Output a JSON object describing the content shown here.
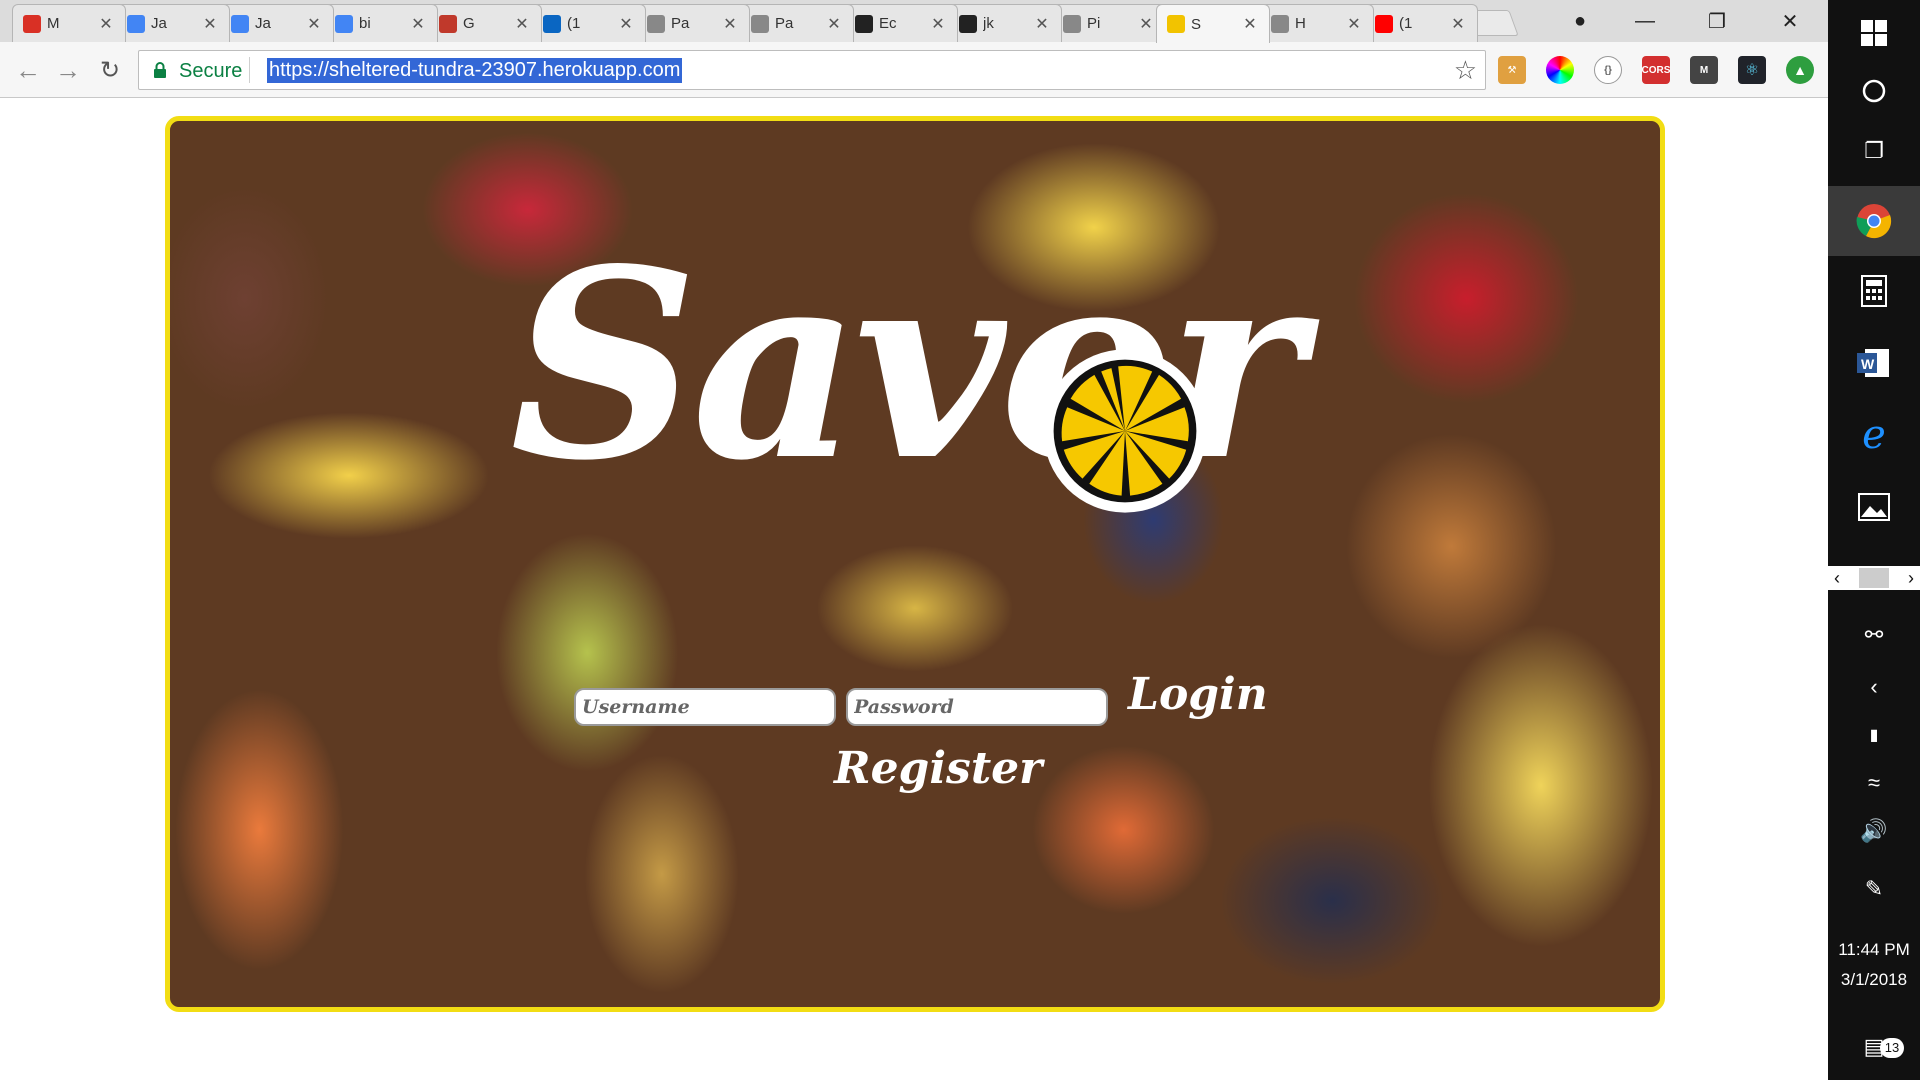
{
  "browser": {
    "tabs": [
      {
        "title": "M",
        "favicon": "gmail-icon",
        "color": "#d93025"
      },
      {
        "title": "Ja",
        "favicon": "docs-icon",
        "color": "#4285f4"
      },
      {
        "title": "Ja",
        "favicon": "docs-icon",
        "color": "#4285f4"
      },
      {
        "title": "bi",
        "favicon": "google-icon",
        "color": "#4285f4"
      },
      {
        "title": "G",
        "favicon": "clapperboard-icon",
        "color": "#c0392b"
      },
      {
        "title": "(1",
        "favicon": "linkedin-icon",
        "color": "#0a66c2"
      },
      {
        "title": "Pa",
        "favicon": "page-icon",
        "color": "#888888"
      },
      {
        "title": "Pa",
        "favicon": "page-icon",
        "color": "#888888"
      },
      {
        "title": "Ec",
        "favicon": "github-icon",
        "color": "#222222"
      },
      {
        "title": "jk",
        "favicon": "github-icon",
        "color": "#222222"
      },
      {
        "title": "Pi",
        "favicon": "page-icon",
        "color": "#888888"
      },
      {
        "title": "S",
        "favicon": "lemon-icon",
        "color": "#f2c300"
      },
      {
        "title": "H",
        "favicon": "page-icon",
        "color": "#888888"
      },
      {
        "title": "(1",
        "favicon": "youtube-icon",
        "color": "#ff0000"
      }
    ],
    "active_tab_index": 11,
    "secure_label": "Secure",
    "url": "https://sheltered-tundra-23907.herokuapp.com"
  },
  "app": {
    "logo_text": "Savor",
    "username_placeholder": "Username",
    "password_placeholder": "Password",
    "login_label": "Login",
    "register_label": "Register",
    "accent_color": "#f2dd14"
  },
  "taskbar": {
    "time": "11:44 PM",
    "date": "3/1/2018",
    "notification_count": "13"
  }
}
